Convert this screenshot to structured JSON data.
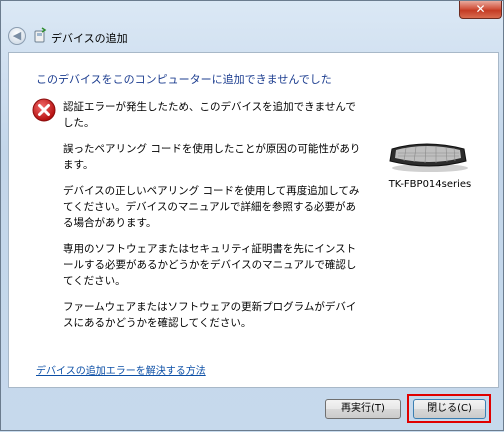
{
  "window": {
    "close_glyph": "✕",
    "title": "デバイスの追加"
  },
  "nav": {
    "back_glyph": "◀"
  },
  "main": {
    "heading": "このデバイスをこのコンピューターに追加できませんでした",
    "paragraphs": [
      "認証エラーが発生したため、このデバイスを追加できませんでした。",
      "誤ったペアリング コードを使用したことが原因の可能性があります。",
      "デバイスの正しいペアリング コードを使用して再度追加してみてください。デバイスのマニュアルで詳細を参照する必要がある場合があります。",
      "専用のソフトウェアまたはセキュリティ証明書を先にインストールする必要があるかどうかをデバイスのマニュアルで確認してください。",
      "ファームウェアまたはソフトウェアの更新プログラムがデバイスにあるかどうかを確認してください。"
    ],
    "device_name": "TK-FBP014series",
    "help_link": "デバイスの追加エラーを解決する方法"
  },
  "buttons": {
    "retry": "再実行(T)",
    "close": "閉じる(C)"
  },
  "colors": {
    "heading": "#1b3c8f",
    "link": "#0c4fa6",
    "highlight": "#e00000",
    "error_icon": "#cc1f1f"
  },
  "icons": {
    "error": "error-icon",
    "wizard": "bluetooth-device-icon",
    "device": "keyboard-icon"
  }
}
